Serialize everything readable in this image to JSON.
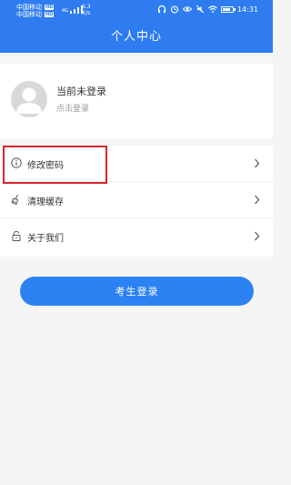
{
  "status_bar": {
    "carrier_1": "中国移动",
    "carrier_2": "中国移动",
    "hd_badge": "HD",
    "network_1": "4G",
    "network_2": "4G",
    "speed_value": "6.3",
    "speed_unit": "K/s",
    "time": "14:31",
    "icons": [
      "headphones-icon",
      "alarm-icon",
      "eye-icon",
      "mute-icon",
      "wifi-icon",
      "battery-icon"
    ]
  },
  "header": {
    "title": "个人中心"
  },
  "profile": {
    "name": "当前未登录",
    "action": "点击登录",
    "avatar_icon": "user-avatar-icon"
  },
  "menu": {
    "items": [
      {
        "label": "修改密码",
        "icon": "info-circle-icon"
      },
      {
        "label": "清理缓存",
        "icon": "broom-icon"
      },
      {
        "label": "关于我们",
        "icon": "lock-icon"
      }
    ]
  },
  "login_button": {
    "label": "考生登录"
  },
  "colors": {
    "primary": "#2e7cf0",
    "button": "#2d82f3",
    "highlight": "#d9252f",
    "background": "#f5f5f5"
  }
}
